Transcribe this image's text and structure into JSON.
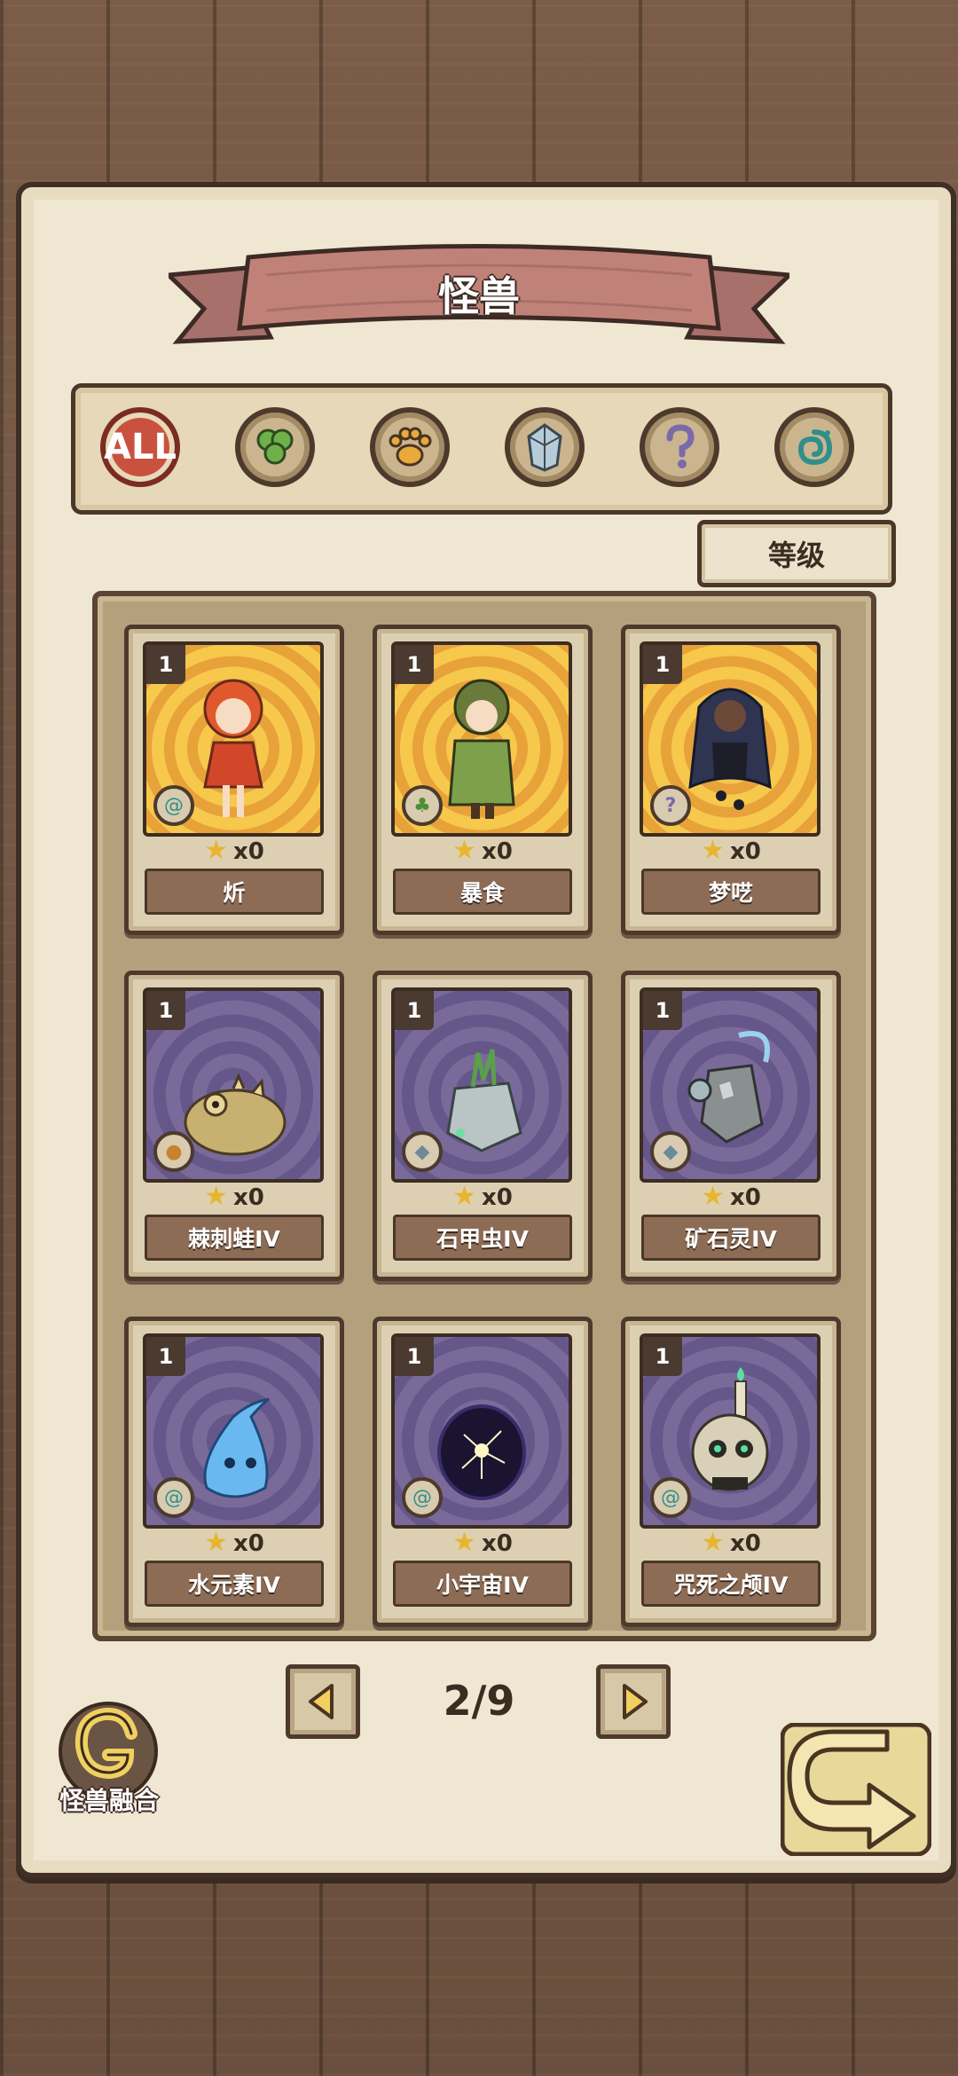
{
  "title": "怪兽",
  "filters": [
    {
      "id": "all",
      "label": "ALL",
      "icon": "all-icon",
      "active": true
    },
    {
      "id": "leaf",
      "label": "",
      "icon": "leaf-icon",
      "active": false
    },
    {
      "id": "paw",
      "label": "",
      "icon": "paw-icon",
      "active": false
    },
    {
      "id": "crystal",
      "label": "",
      "icon": "crystal-icon",
      "active": false
    },
    {
      "id": "question",
      "label": "",
      "icon": "question-icon",
      "active": false
    },
    {
      "id": "spiral",
      "label": "",
      "icon": "spiral-icon",
      "active": false
    }
  ],
  "sort_label": "等级",
  "cards": [
    {
      "level": "1",
      "name": "炘",
      "count": "x0",
      "bg": "gold",
      "element_icon": "spiral-icon"
    },
    {
      "level": "1",
      "name": "暴食",
      "count": "x0",
      "bg": "gold",
      "element_icon": "leaf-icon"
    },
    {
      "level": "1",
      "name": "梦呓",
      "count": "x0",
      "bg": "gold",
      "element_icon": "question-icon"
    },
    {
      "level": "1",
      "name": "棘刺蛙IV",
      "count": "x0",
      "bg": "purple",
      "element_icon": "paw-icon"
    },
    {
      "level": "1",
      "name": "石甲虫IV",
      "count": "x0",
      "bg": "purple",
      "element_icon": "crystal-icon"
    },
    {
      "level": "1",
      "name": "矿石灵IV",
      "count": "x0",
      "bg": "purple",
      "element_icon": "crystal-icon"
    },
    {
      "level": "1",
      "name": "水元素IV",
      "count": "x0",
      "bg": "purple",
      "element_icon": "spiral-icon"
    },
    {
      "level": "1",
      "name": "小宇宙IV",
      "count": "x0",
      "bg": "purple",
      "element_icon": "spiral-icon"
    },
    {
      "level": "1",
      "name": "咒死之颅IV",
      "count": "x0",
      "bg": "purple",
      "element_icon": "spiral-icon"
    }
  ],
  "pagination": {
    "current": "2/9"
  },
  "fusion_label": "怪兽融合",
  "colors": {
    "accent_red": "#c9523e",
    "gold_bg": "#f6c84c",
    "purple_bg": "#7a6a9a",
    "ink": "#3b2c22"
  }
}
